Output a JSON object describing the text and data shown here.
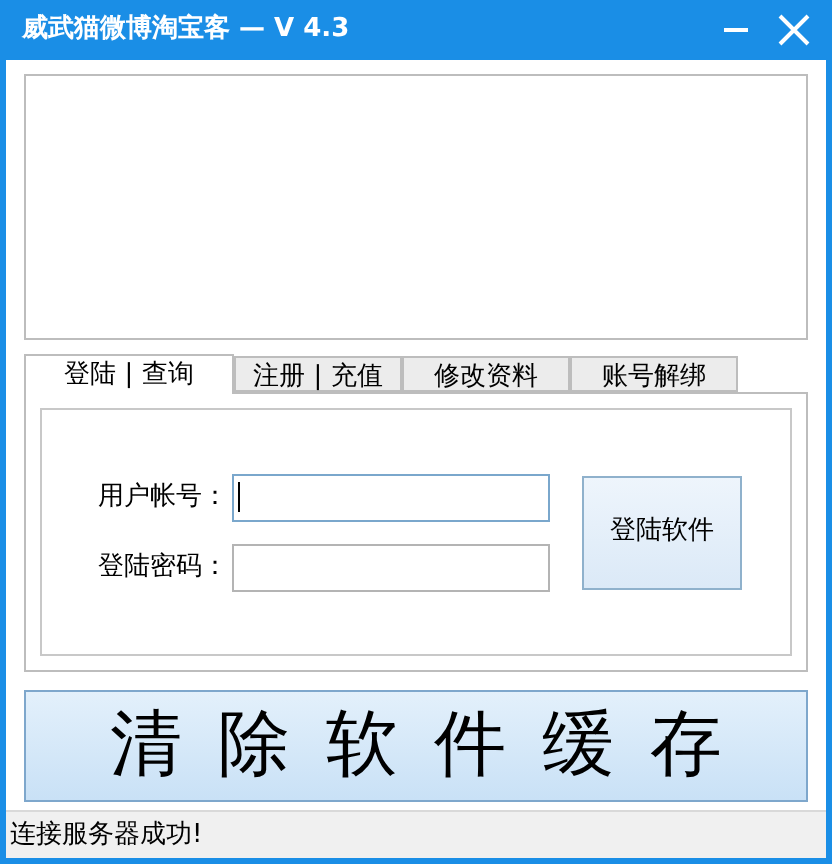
{
  "window": {
    "title": "威武猫微博淘宝客 — V 4.3"
  },
  "tabs": [
    {
      "label": "登陆 | 查询",
      "selected": true
    },
    {
      "label": "注册 | 充值",
      "selected": false
    },
    {
      "label": "修改资料",
      "selected": false
    },
    {
      "label": "账号解绑",
      "selected": false
    }
  ],
  "login_form": {
    "fields": [
      {
        "label": "用户帐号：",
        "focused": true
      },
      {
        "label": "登陆密码：",
        "focused": false
      }
    ],
    "button": "登陆软件"
  },
  "clear_cache_button": "清除软件缓存",
  "status_bar": "连接服务器成功!"
}
